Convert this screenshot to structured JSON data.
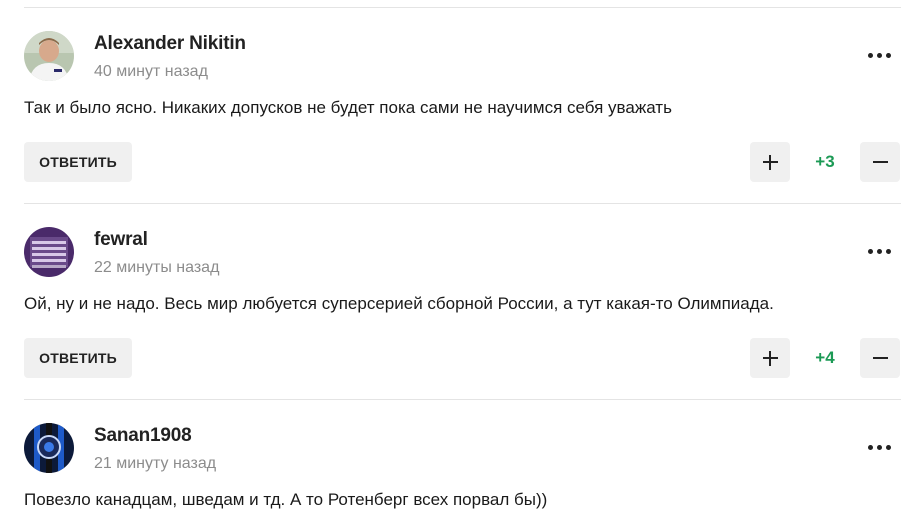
{
  "colors": {
    "accent_score": "#1c9a55",
    "button_bg": "#f0f0f0",
    "meta_text": "#8c8c8c"
  },
  "comments": [
    {
      "author": "Alexander Nikitin",
      "time": "40 минут назад",
      "text": "Так и было ясно. Никаких допусков не будет пока сами не научимся себя уважать",
      "reply_label": "ОТВЕТИТЬ",
      "score": "+3",
      "avatar": "user-photo-avatar"
    },
    {
      "author": "fewral",
      "time": "22 минуты назад",
      "text": "Ой, ну и не надо. Весь мир любуется суперсерией сборной России, а тут какая-то Олимпиада.",
      "reply_label": "ОТВЕТИТЬ",
      "score": "+4",
      "avatar": "user-photo-avatar"
    },
    {
      "author": "Sanan1908",
      "time": "21 минуту назад",
      "text": "Повезло канадцам, шведам и тд. А то Ротенберг всех порвал бы))",
      "avatar": "user-photo-avatar"
    }
  ]
}
